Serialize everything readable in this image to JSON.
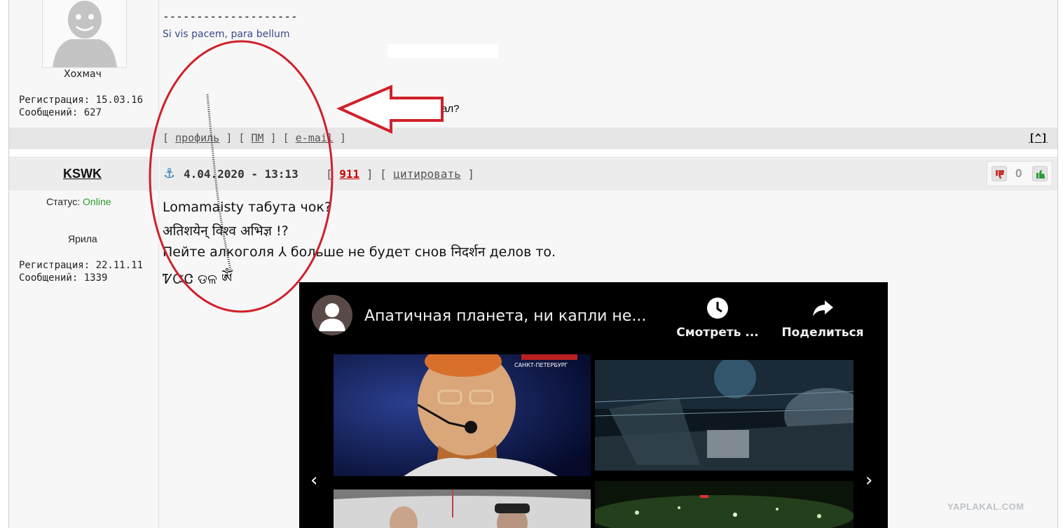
{
  "post1": {
    "username": "Хохмач",
    "registration": "Регистрация: 15.03.16",
    "messages": "Сообщений: 627",
    "signature_dashes": "--------------------",
    "signature": "Si vis pacem, para bellum",
    "annotation": "Как ты это сделал?",
    "links": {
      "open": "[",
      "profile": "профиль",
      "sep1": "] [",
      "pm": "ПМ",
      "sep2": "] [",
      "email": "e-mail",
      "close": "]"
    },
    "up_link": "[^]"
  },
  "post2": {
    "username": "KSWK",
    "status_label": "Статус:",
    "status_value": "Online",
    "rank": "Ярила",
    "registration": "Регистрация: 22.11.11",
    "messages": "Сообщений: 1339",
    "anchor_glyph": "⚓",
    "datetime": "4.04.2020 - 13:13",
    "link_open": "[",
    "post_number": "911",
    "link_mid": "] [",
    "quote": "цитировать",
    "link_close": "]",
    "rating": "0",
    "body": [
      "Lomamaisty табута чок?",
      "अतिशयेन् विश्व अभिज्ञ !?",
      "Пейте алкоголя ⅄ больше не будет снов निदर्शन делов то.",
      "ᏤᏨᏣ ଡଳ ༀ"
    ]
  },
  "video": {
    "title": "Апатичная планета, ни капли не...",
    "watch_later": "Смотреть ...",
    "share": "Поделиться",
    "prev_arrow": "‹",
    "next_arrow": "›",
    "thumb_caption": "САНКТ-ПЕТЕРБУРГ"
  },
  "watermark": "YAPLAKAL.COM",
  "colors": {
    "annotation_red": "#d0202a",
    "online_green": "#2c9c2c",
    "link_red": "#cc0000",
    "signature_blue": "#3b4a8a"
  },
  "icons": [
    "anchor-icon",
    "dislike-icon",
    "like-icon",
    "clock-icon",
    "share-icon",
    "chevron-left-icon",
    "chevron-right-icon"
  ]
}
